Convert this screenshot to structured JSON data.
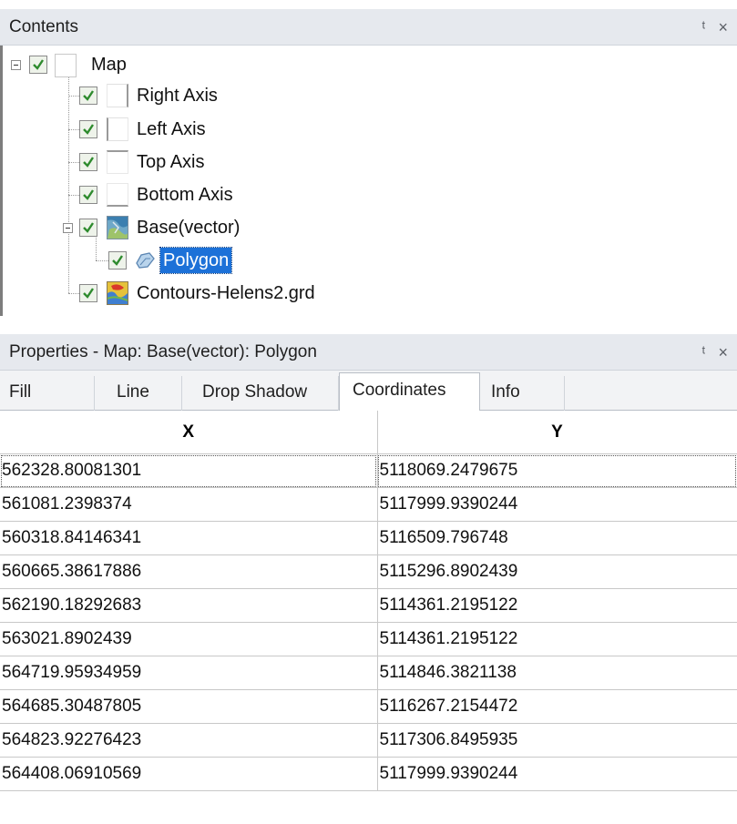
{
  "contents": {
    "title": "Contents",
    "controls": [
      "pin-icon",
      "close-icon"
    ],
    "tree": [
      {
        "label": "Map",
        "checked": true,
        "expanded": true,
        "icon": "map-icon"
      },
      {
        "label": "Right Axis",
        "checked": true,
        "icon": "right-axis-icon"
      },
      {
        "label": "Left Axis",
        "checked": true,
        "icon": "left-axis-icon"
      },
      {
        "label": "Top Axis",
        "checked": true,
        "icon": "top-axis-icon"
      },
      {
        "label": "Bottom Axis",
        "checked": true,
        "icon": "bottom-axis-icon"
      },
      {
        "label": "Base(vector)",
        "checked": true,
        "expanded": true,
        "icon": "base-vector-icon"
      },
      {
        "label": "Polygon",
        "checked": true,
        "selected": true,
        "icon": "polygon-icon"
      },
      {
        "label": "Contours-Helens2.grd",
        "checked": true,
        "icon": "contours-icon"
      }
    ]
  },
  "properties": {
    "title": "Properties - Map: Base(vector): Polygon",
    "controls": [
      "pin-icon",
      "close-icon"
    ],
    "tabs": [
      "Fill",
      "Line",
      "Drop Shadow",
      "Coordinates",
      "Info"
    ],
    "active_tab": "Coordinates",
    "grid": {
      "columns": [
        "X",
        "Y"
      ],
      "rows": [
        [
          "562328.80081301",
          "5118069.2479675"
        ],
        [
          "561081.2398374",
          "5117999.9390244"
        ],
        [
          "560318.84146341",
          "5116509.796748"
        ],
        [
          "560665.38617886",
          "5115296.8902439"
        ],
        [
          "562190.18292683",
          "5114361.2195122"
        ],
        [
          "563021.8902439",
          "5114361.2195122"
        ],
        [
          "564719.95934959",
          "5114846.3821138"
        ],
        [
          "564685.30487805",
          "5116267.2154472"
        ],
        [
          "564823.92276423",
          "5117306.8495935"
        ],
        [
          "564408.06910569",
          "5117999.9390244"
        ]
      ]
    }
  },
  "colors": {
    "titlebar_bg": "#e6e9ee",
    "selection": "#1c71d8",
    "check": "#2e8b2e"
  }
}
